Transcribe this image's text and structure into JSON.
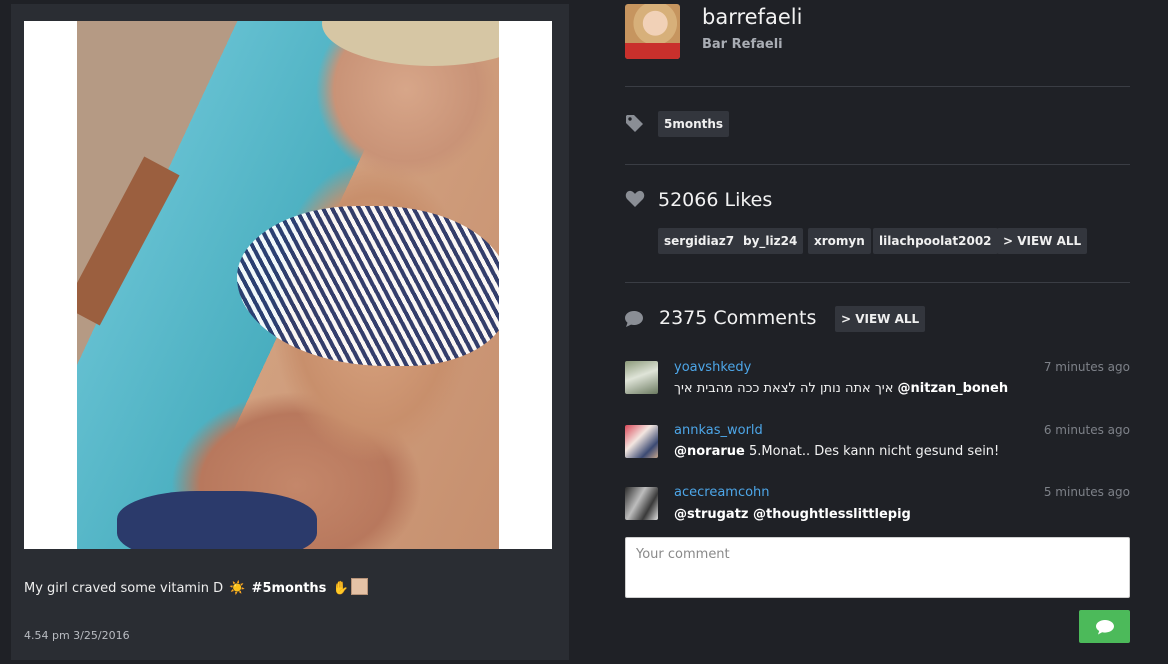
{
  "post": {
    "caption_text": "My girl craved some vitamin D",
    "caption_sun": "☀️",
    "caption_hashtag": "#5months",
    "caption_hand": "✋",
    "timestamp": "4.54 pm 3/25/2016"
  },
  "profile": {
    "username": "barrefaeli",
    "full_name": "Bar Refaeli"
  },
  "tags": [
    "5months"
  ],
  "likes": {
    "count_label": "52066 Likes",
    "users": [
      "sergidiaz7",
      "by_liz24",
      "xromyn",
      "lilachpoolat2002"
    ],
    "view_all_label": "> VIEW ALL"
  },
  "comments": {
    "count_label": "2375 Comments",
    "view_all_label": "> VIEW ALL",
    "items": [
      {
        "user": "yoavshkedy",
        "time": "7 minutes ago",
        "mention": "@nitzan_boneh",
        "text": "איך אתה נותן לה לצאת ככה מהבית איך"
      },
      {
        "user": "annkas_world",
        "time": "6 minutes ago",
        "mention": "@norarue",
        "text": "5.Monat.. Des kann nicht gesund sein!"
      },
      {
        "user": "acecreamcohn",
        "time": "5 minutes ago",
        "mention": "@strugatz @thoughtlesslittlepig",
        "text": ""
      }
    ]
  },
  "comment_input": {
    "placeholder": "Your comment",
    "value": ""
  },
  "icons": {
    "tag": "tag-icon",
    "likes": "heart-icon",
    "comments": "speech-bubble-icon",
    "send": "chat-bubble-icon"
  },
  "colors": {
    "background": "#1f2126",
    "card": "#2a2d33",
    "chip": "#33363d",
    "username_link": "#4da6e8",
    "send_button": "#4cba5a"
  }
}
